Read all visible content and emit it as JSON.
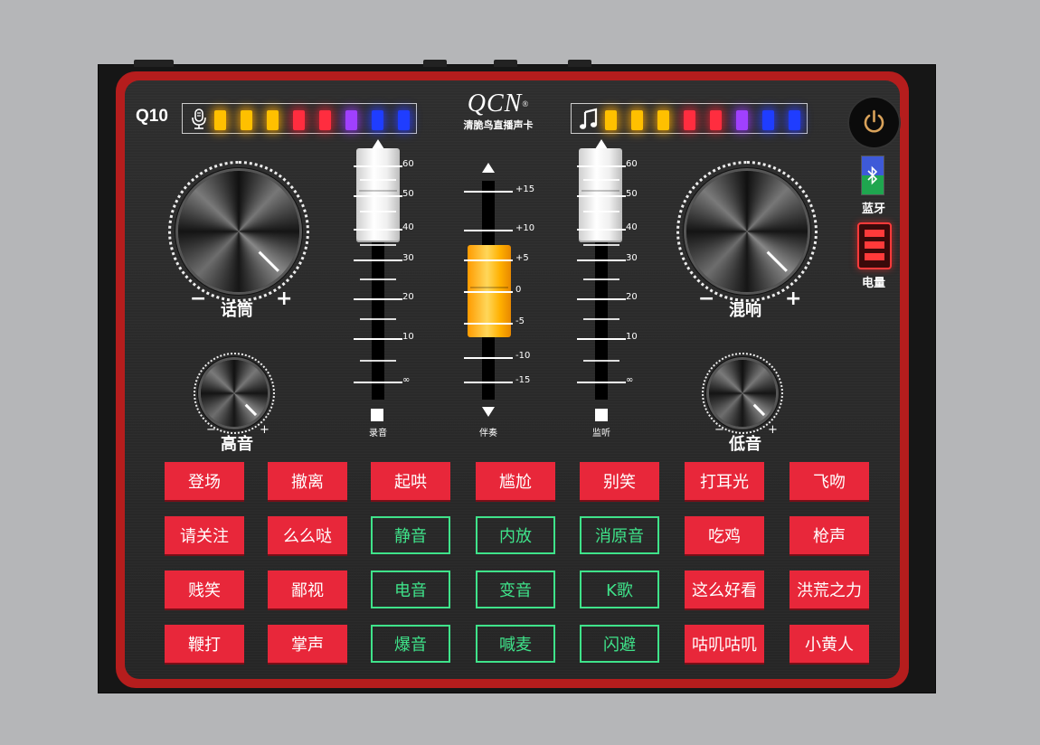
{
  "device": {
    "model": "Q10",
    "brand_logo": "QCN",
    "brand_registered": "®",
    "brand_subtitle": "清脆鸟直播声卡"
  },
  "indicators": {
    "mic_led_colors": [
      "#ffc000",
      "#ffc000",
      "#ffc000",
      "#ff2d3f",
      "#ff2d3f",
      "#a040ff",
      "#1f3dff",
      "#1f3dff"
    ],
    "music_led_colors": [
      "#ffc000",
      "#ffc000",
      "#ffc000",
      "#ff2d3f",
      "#ff2d3f",
      "#a040ff",
      "#1f3dff",
      "#1f3dff"
    ]
  },
  "knobs": {
    "mic": {
      "label": "话筒",
      "minus": "−",
      "plus": "+"
    },
    "reverb": {
      "label": "混响",
      "minus": "−",
      "plus": "+"
    },
    "treble": {
      "label": "高音",
      "minus": "−",
      "plus": "+"
    },
    "bass": {
      "label": "低音",
      "minus": "−",
      "plus": "+"
    }
  },
  "faders": {
    "record": {
      "label": "录音",
      "scale": [
        "60",
        "50",
        "40",
        "30",
        "20",
        "10",
        "∞"
      ]
    },
    "accompany": {
      "label": "伴奏",
      "scale": [
        "+15",
        "+10",
        "+5",
        "0",
        "-5",
        "-10",
        "-15"
      ]
    },
    "monitor": {
      "label": "监听",
      "scale": [
        "60",
        "50",
        "40",
        "30",
        "20",
        "10",
        "∞"
      ]
    }
  },
  "status": {
    "bluetooth_label": "蓝牙",
    "battery_label": "电量"
  },
  "pads": [
    {
      "label": "登场",
      "style": "red"
    },
    {
      "label": "撤离",
      "style": "red"
    },
    {
      "label": "起哄",
      "style": "red"
    },
    {
      "label": "尴尬",
      "style": "red"
    },
    {
      "label": "别笑",
      "style": "red"
    },
    {
      "label": "打耳光",
      "style": "red"
    },
    {
      "label": "飞吻",
      "style": "red"
    },
    {
      "label": "请关注",
      "style": "red"
    },
    {
      "label": "么么哒",
      "style": "red"
    },
    {
      "label": "静音",
      "style": "green"
    },
    {
      "label": "内放",
      "style": "green"
    },
    {
      "label": "消原音",
      "style": "green"
    },
    {
      "label": "吃鸡",
      "style": "red"
    },
    {
      "label": "枪声",
      "style": "red"
    },
    {
      "label": "贱笑",
      "style": "red"
    },
    {
      "label": "鄙视",
      "style": "red"
    },
    {
      "label": "电音",
      "style": "green"
    },
    {
      "label": "变音",
      "style": "green"
    },
    {
      "label": "K歌",
      "style": "green"
    },
    {
      "label": "这么好看",
      "style": "red"
    },
    {
      "label": "洪荒之力",
      "style": "red"
    },
    {
      "label": "鞭打",
      "style": "red"
    },
    {
      "label": "掌声",
      "style": "red"
    },
    {
      "label": "爆音",
      "style": "green"
    },
    {
      "label": "喊麦",
      "style": "green"
    },
    {
      "label": "闪避",
      "style": "green"
    },
    {
      "label": "咕叽咕叽",
      "style": "red"
    },
    {
      "label": "小黄人",
      "style": "red"
    }
  ]
}
